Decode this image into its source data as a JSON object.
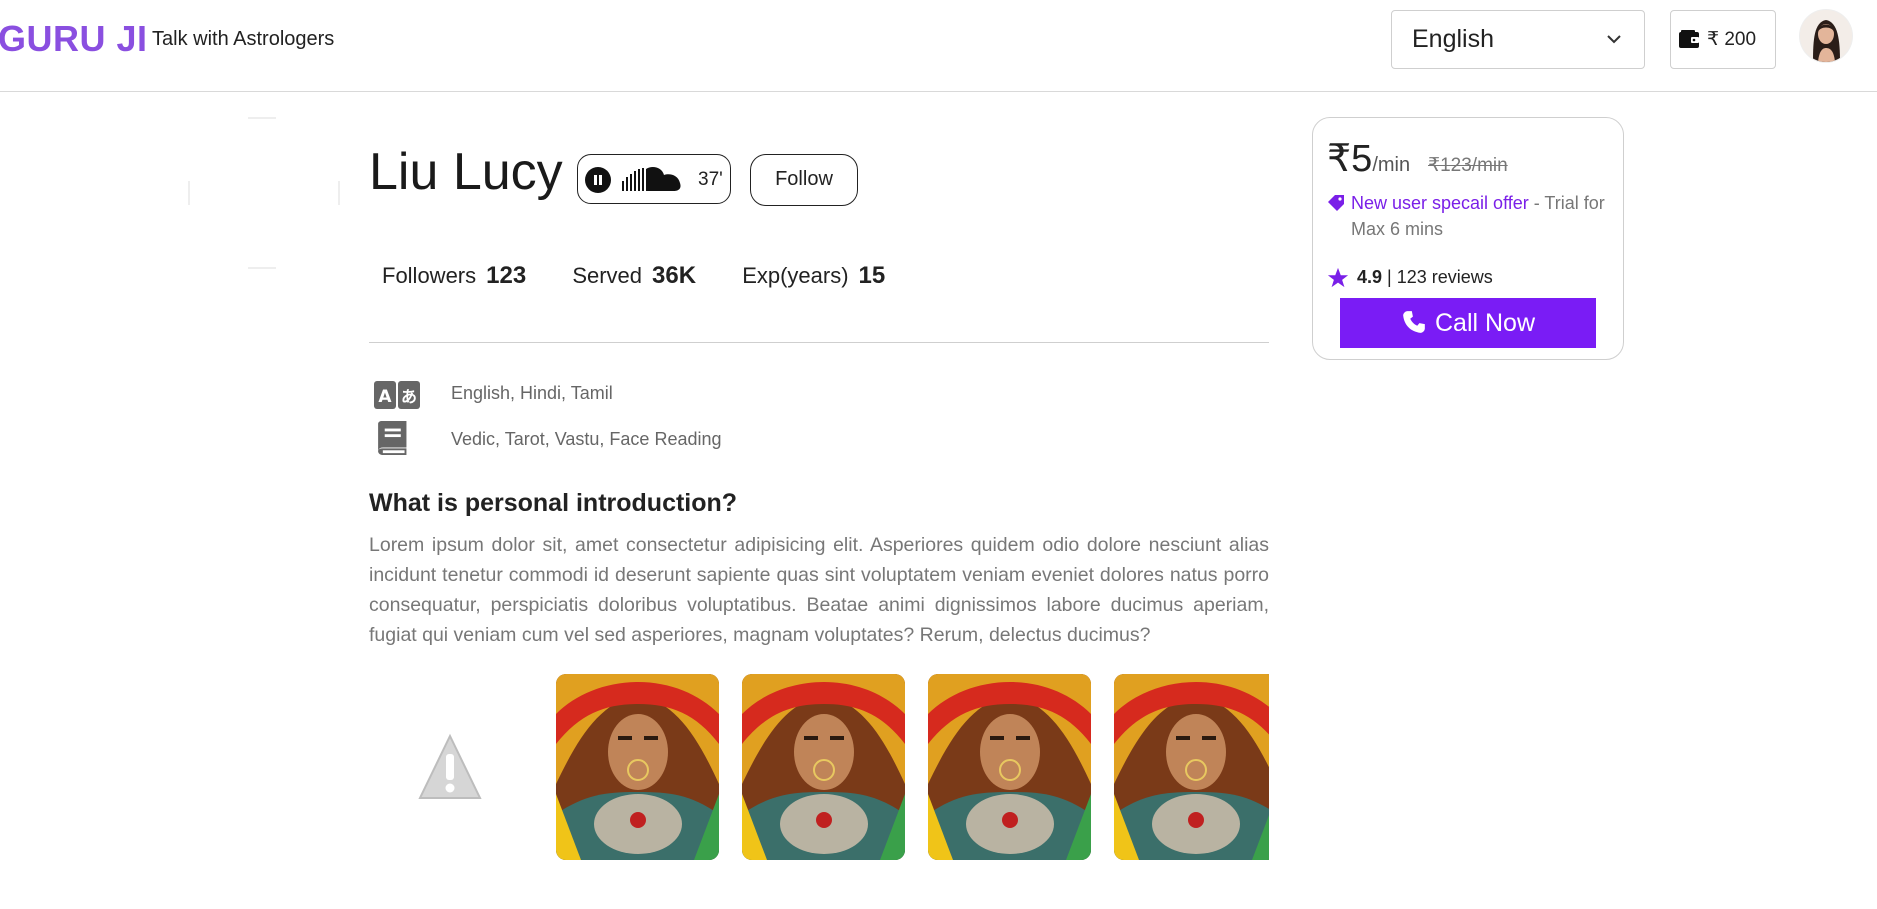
{
  "header": {
    "logo": "GURU JI",
    "tagline": "Talk with Astrologers",
    "language": {
      "selected": "English"
    },
    "wallet": {
      "amount": "₹ 200"
    }
  },
  "profile": {
    "name": "Liu Lucy",
    "audio_duration": "37'",
    "follow_label": "Follow",
    "stats": [
      {
        "label": "Followers",
        "value": "123"
      },
      {
        "label": "Served",
        "value": "36K"
      },
      {
        "label": "Exp(years)",
        "value": "15"
      }
    ],
    "languages": "English, Hindi, Tamil",
    "skills": "Vedic, Tarot, Vastu, Face Reading",
    "intro_title": "What is personal introduction?",
    "intro_text": "Lorem ipsum dolor sit, amet consectetur adipisicing elit. Asperiores quidem odio dolore nesciunt alias incidunt tenetur commodi id deserunt sapiente quas sint voluptatem veniam eveniet dolores natus porro consequatur, perspiciatis doloribus voluptatibus. Beatae animi dignissimos labore ducimus aperiam, fugiat qui veniam cum vel sed asperiores, magnam voluptates? Rerum, delectus ducimus?"
  },
  "pricing": {
    "price": "₹5",
    "per_min": "/min",
    "old_price": "₹123/min",
    "offer_link": "New user specail offer",
    "offer_rest": " - Trial for Max 6 mins",
    "rating": "4.9",
    "reviews": " | 123 reviews",
    "call_label": "Call Now"
  },
  "colors": {
    "brand": "#8a4fe0",
    "accent": "#7a1cf5",
    "offer": "#7a1fe8"
  },
  "icons": [
    "wallet-icon",
    "chevron-down-icon",
    "pause-icon",
    "soundcloud-icon",
    "translate-icon",
    "book-icon",
    "warning-icon",
    "tag-icon",
    "star-icon",
    "phone-icon"
  ]
}
